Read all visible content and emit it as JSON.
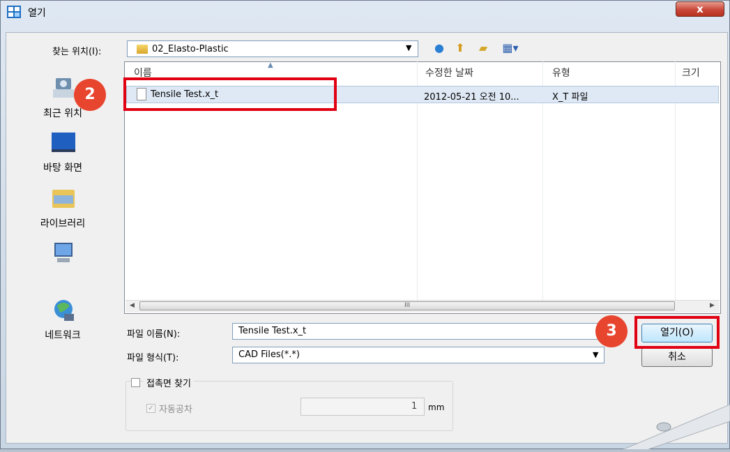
{
  "window": {
    "title": "열기",
    "close_label": "x"
  },
  "toolbar": {
    "lookin_label": "찾는 위치(I):",
    "lookin_value": "02_Elasto-Plastic"
  },
  "places": [
    {
      "label": "최근 위치"
    },
    {
      "label": "바탕 화면"
    },
    {
      "label": "라이브러리"
    },
    {
      "label": ""
    },
    {
      "label": "네트워크"
    }
  ],
  "list": {
    "columns": [
      "이름",
      "수정한 날짜",
      "유형",
      "크기"
    ],
    "rows": [
      {
        "name": "Tensile Test.x_t",
        "date": "2012-05-21 오전 10...",
        "type": "X_T 파일",
        "size": ""
      }
    ],
    "scroll_glyph": "III"
  },
  "form": {
    "filename_label": "파일 이름(N):",
    "filename_value": "Tensile Test.x_t",
    "filetype_label": "파일 형식(T):",
    "filetype_value": "CAD Files(*.*)",
    "open_label": "열기(O)",
    "cancel_label": "취소"
  },
  "contact": {
    "group_label": "접촉면 찾기",
    "auto_label": "자동공차",
    "tolerance_value": "1",
    "unit": "mm"
  },
  "annotations": {
    "step2": "2",
    "step3": "3"
  },
  "colors": {
    "accent_red": "#e00012",
    "badge": "#e8452f",
    "selection": "#dfe9f5"
  }
}
